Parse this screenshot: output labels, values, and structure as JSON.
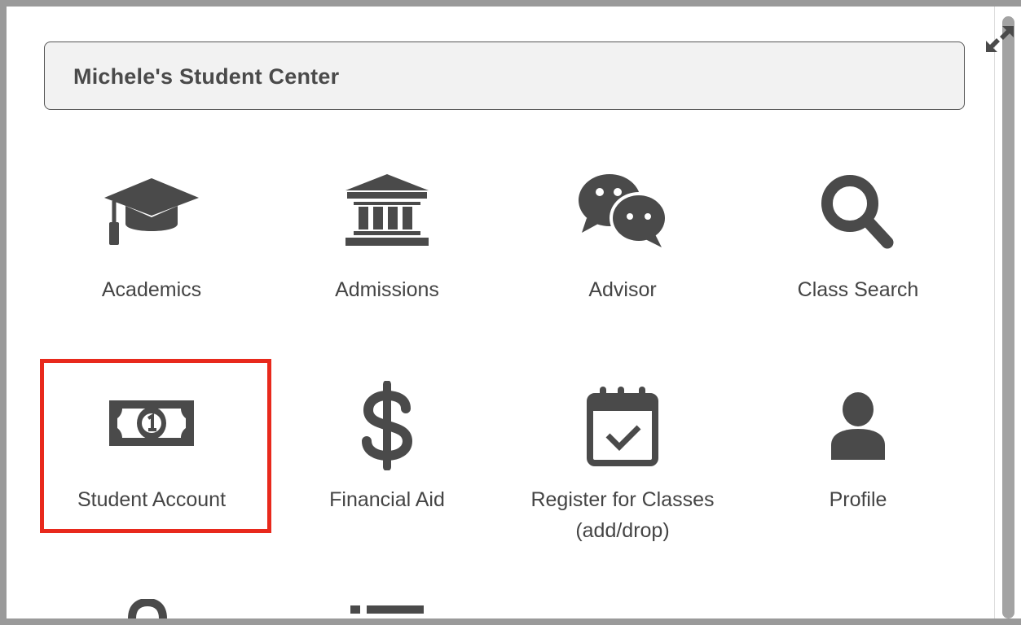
{
  "header": {
    "title": "Michele's Student Center"
  },
  "tiles": [
    {
      "label": "Academics",
      "icon": "graduation-cap-icon"
    },
    {
      "label": "Admissions",
      "icon": "institution-icon"
    },
    {
      "label": "Advisor",
      "icon": "chat-bubbles-icon"
    },
    {
      "label": "Class Search",
      "icon": "search-icon"
    },
    {
      "label": "Student Account",
      "icon": "money-bill-icon"
    },
    {
      "label": "Financial Aid",
      "icon": "dollar-icon"
    },
    {
      "label": "Register for Classes",
      "label2": "(add/drop)",
      "icon": "calendar-check-icon"
    },
    {
      "label": "Profile",
      "icon": "user-icon"
    }
  ],
  "colors": {
    "icon": "#4a4a4a",
    "highlight": "#e8291c",
    "header_bg": "#f2f2f2"
  }
}
